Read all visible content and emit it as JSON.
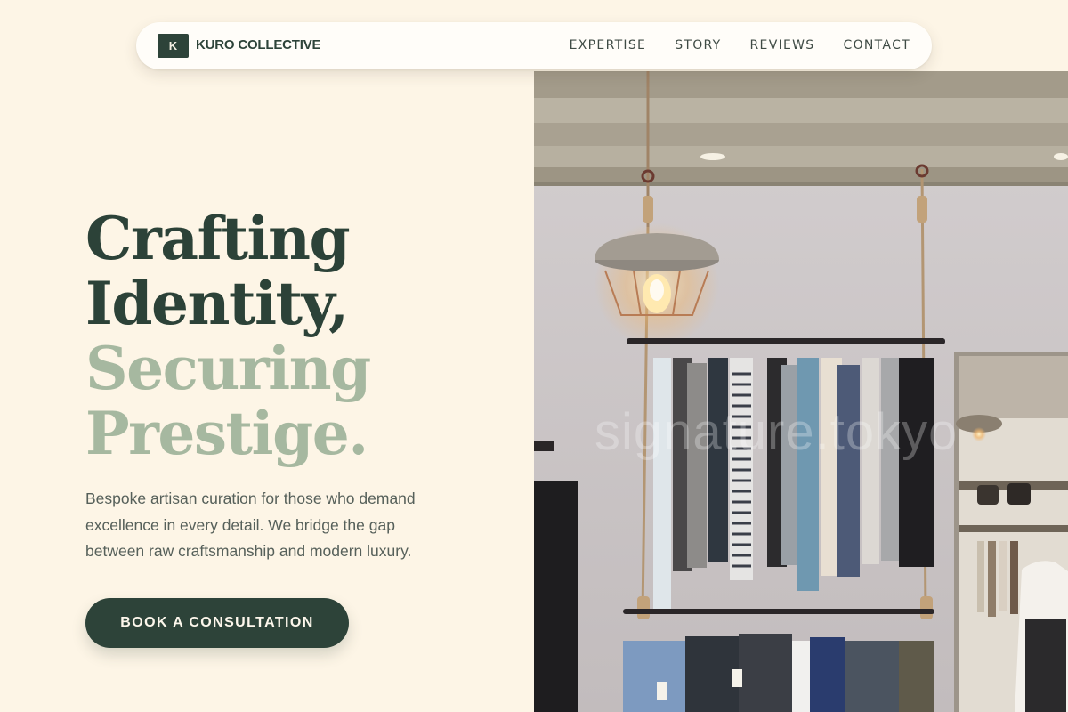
{
  "nav": {
    "logo_letter": "K",
    "brand": "KURO COLLECTIVE",
    "links": [
      {
        "label": "EXPERTISE"
      },
      {
        "label": "STORY"
      },
      {
        "label": "REVIEWS"
      },
      {
        "label": "CONTACT"
      }
    ]
  },
  "hero": {
    "headline": [
      "Crafting",
      "Identity,",
      "Securing",
      "Prestige."
    ],
    "description": "Bespoke artisan curation for those who demand excellence in every detail. We bridge the gap between raw craftsmanship and modern luxury.",
    "cta_label": "BOOK A CONSULTATION",
    "image_watermark": "signature.tokyo"
  },
  "colors": {
    "background": "#fdf5e6",
    "primary": "#2d4339",
    "accent_sage": "#a6b8a0",
    "body_text": "#56605a"
  }
}
